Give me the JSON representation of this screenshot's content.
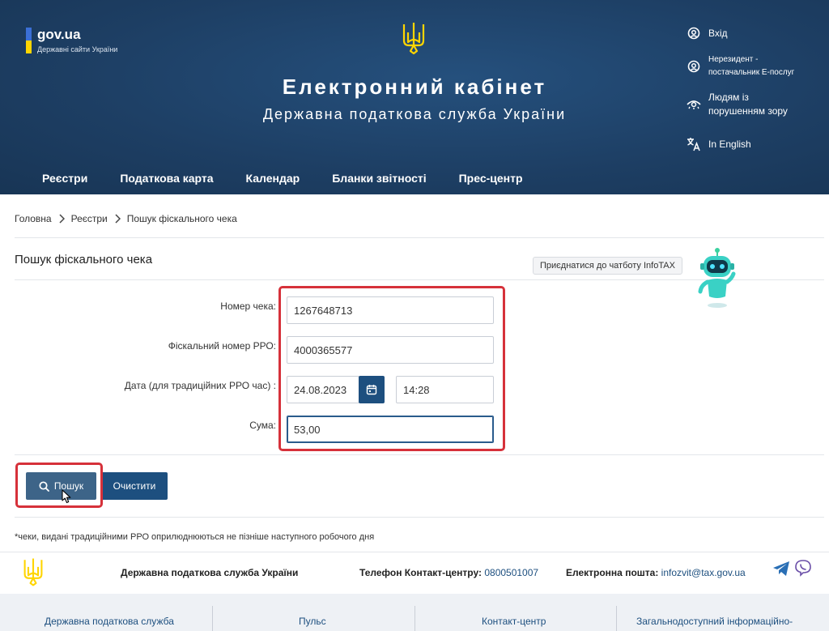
{
  "header": {
    "gov_name": "gov.ua",
    "gov_sub": "Державні сайти України",
    "title": "Електронний кабінет",
    "subtitle": "Державна податкова служба України",
    "links": {
      "login": "Вхід",
      "nonresident_1": "Нерезидент -",
      "nonresident_2": "постачальник Е-послуг",
      "vision_1": "Людям із",
      "vision_2": "порушенням зору",
      "english": "In English"
    },
    "nav": [
      "Реєстри",
      "Податкова карта",
      "Календар",
      "Бланки звітності",
      "Прес-центр"
    ]
  },
  "breadcrumb": [
    "Головна",
    "Реєстри",
    "Пошук фіскального чека"
  ],
  "page_title": "Пошук фіскального чека",
  "chatbot": {
    "label": "Приєднатися до чатботу InfoTAX"
  },
  "form": {
    "receipt_label": "Номер чека:",
    "receipt_value": "1267648713",
    "fiscal_label": "Фіскальний номер РРО:",
    "fiscal_value": "4000365577",
    "date_label": "Дата (для традиційних РРО час) :",
    "date_value": "24.08.2023",
    "time_value": "14:28",
    "sum_label": "Сума:",
    "sum_value": "53,00"
  },
  "buttons": {
    "search": "Пошук",
    "clear": "Очистити"
  },
  "note": "*чеки, видані традиційними РРО оприлюднюються не пізніше наступного робочого дня",
  "footer": {
    "org": "Державна податкова служба України",
    "phone_label": "Телефон Контакт-центру:",
    "phone_value": "0800501007",
    "email_label": "Електронна пошта:",
    "email_value": "infozvit@tax.gov.ua"
  },
  "bottom_links": [
    "Державна податкова служба",
    "Пульс",
    "Контакт-центр",
    "Загальнодоступний інформаційно-"
  ],
  "colors": {
    "header_bg": "#1d3e63",
    "accent": "#1d4f7f",
    "highlight": "#d6313a",
    "ua_yellow": "#ffd500",
    "ua_blue": "#3b6fd6"
  }
}
